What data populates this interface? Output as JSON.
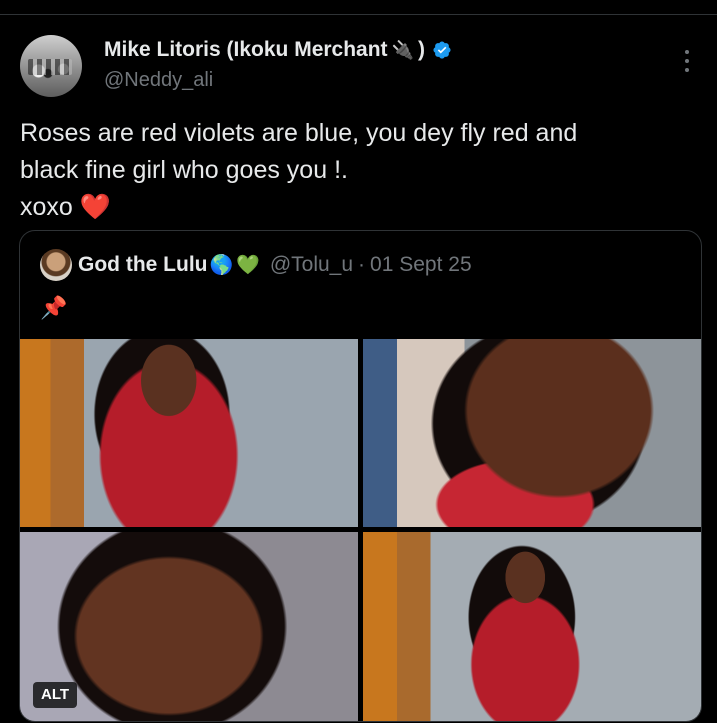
{
  "author": {
    "name": "Mike Litoris (Ikoku Merchant",
    "name_emoji": "🔌",
    "name_close": ")",
    "handle": "@Neddy_ali"
  },
  "tweet": {
    "text_lines": "Roses are red violets are blue, you dey fly red and\nblack fine girl who goes you !.\nxoxo ",
    "heart_emoji": "❤️"
  },
  "quoted": {
    "name": "God the Lulu",
    "emoji_globe": "🌎",
    "emoji_heart": "💚",
    "handle": "@Tolu_u",
    "separator": "·",
    "date": "01 Sept 25",
    "text": "📌",
    "alt_label": "ALT"
  },
  "colors": {
    "background": "#000000",
    "text": "#e7e9ea",
    "secondary": "#71767b",
    "border": "#2f3336",
    "verified": "#1d9bf0"
  },
  "icons": [
    "verified-badge-icon",
    "more-options-icon"
  ]
}
